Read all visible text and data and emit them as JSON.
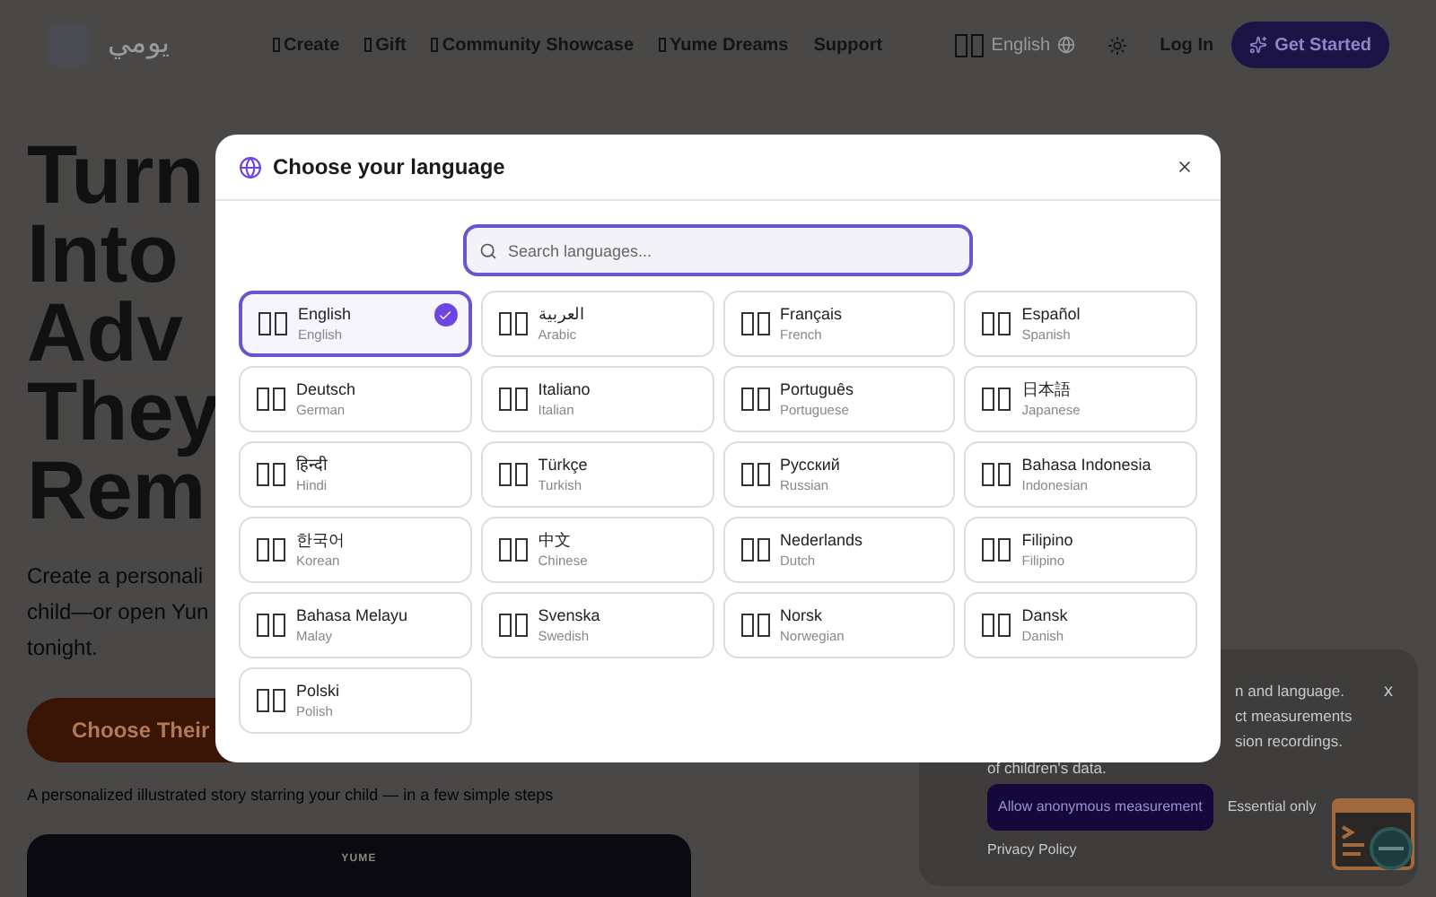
{
  "header": {
    "logo_text": "يومي",
    "nav": [
      {
        "label": "Create",
        "kind": "icon"
      },
      {
        "label": "Gift",
        "kind": "icon"
      },
      {
        "label": "Community Showcase",
        "kind": "icon"
      },
      {
        "label": "Yume Dreams",
        "kind": "icon"
      },
      {
        "label": "Support",
        "kind": "text"
      }
    ],
    "language": "English",
    "login": "Log In",
    "cta": "Get Started"
  },
  "hero": {
    "title_lines": [
      "Turn",
      "Into",
      "Adv",
      "They",
      "Rem"
    ],
    "subtitle_lines": [
      "Create a personali",
      "child—or open Yun",
      "tonight."
    ],
    "button": "Choose Their",
    "caption": "A personalized illustrated story starring your child — in a few simple steps",
    "card_text": "YUME"
  },
  "cookie_banner": {
    "lines": [
      "n and language.",
      "ct measurements",
      "sion recordings."
    ],
    "last_line": "of children's data.",
    "accept": "Allow anonymous measurement",
    "essential": "Essential only",
    "privacy": "Privacy Policy",
    "close": "x"
  },
  "dialog": {
    "title": "Choose your language",
    "search": {
      "placeholder": "Search languages..."
    },
    "languages": [
      {
        "native": "English",
        "english": "English",
        "selected": true
      },
      {
        "native": "العربية",
        "english": "Arabic",
        "selected": false
      },
      {
        "native": "Français",
        "english": "French",
        "selected": false
      },
      {
        "native": "Español",
        "english": "Spanish",
        "selected": false
      },
      {
        "native": "Deutsch",
        "english": "German",
        "selected": false
      },
      {
        "native": "Italiano",
        "english": "Italian",
        "selected": false
      },
      {
        "native": "Português",
        "english": "Portuguese",
        "selected": false
      },
      {
        "native": "日本語",
        "english": "Japanese",
        "selected": false
      },
      {
        "native": "हिन्दी",
        "english": "Hindi",
        "selected": false
      },
      {
        "native": "Türkçe",
        "english": "Turkish",
        "selected": false
      },
      {
        "native": "Русский",
        "english": "Russian",
        "selected": false
      },
      {
        "native": "Bahasa Indonesia",
        "english": "Indonesian",
        "selected": false
      },
      {
        "native": "한국어",
        "english": "Korean",
        "selected": false
      },
      {
        "native": "中文",
        "english": "Chinese",
        "selected": false
      },
      {
        "native": "Nederlands",
        "english": "Dutch",
        "selected": false
      },
      {
        "native": "Filipino",
        "english": "Filipino",
        "selected": false
      },
      {
        "native": "Bahasa Melayu",
        "english": "Malay",
        "selected": false
      },
      {
        "native": "Svenska",
        "english": "Swedish",
        "selected": false
      },
      {
        "native": "Norsk",
        "english": "Norwegian",
        "selected": false
      },
      {
        "native": "Dansk",
        "english": "Danish",
        "selected": false
      },
      {
        "native": "Polski",
        "english": "Polish",
        "selected": false
      }
    ]
  }
}
